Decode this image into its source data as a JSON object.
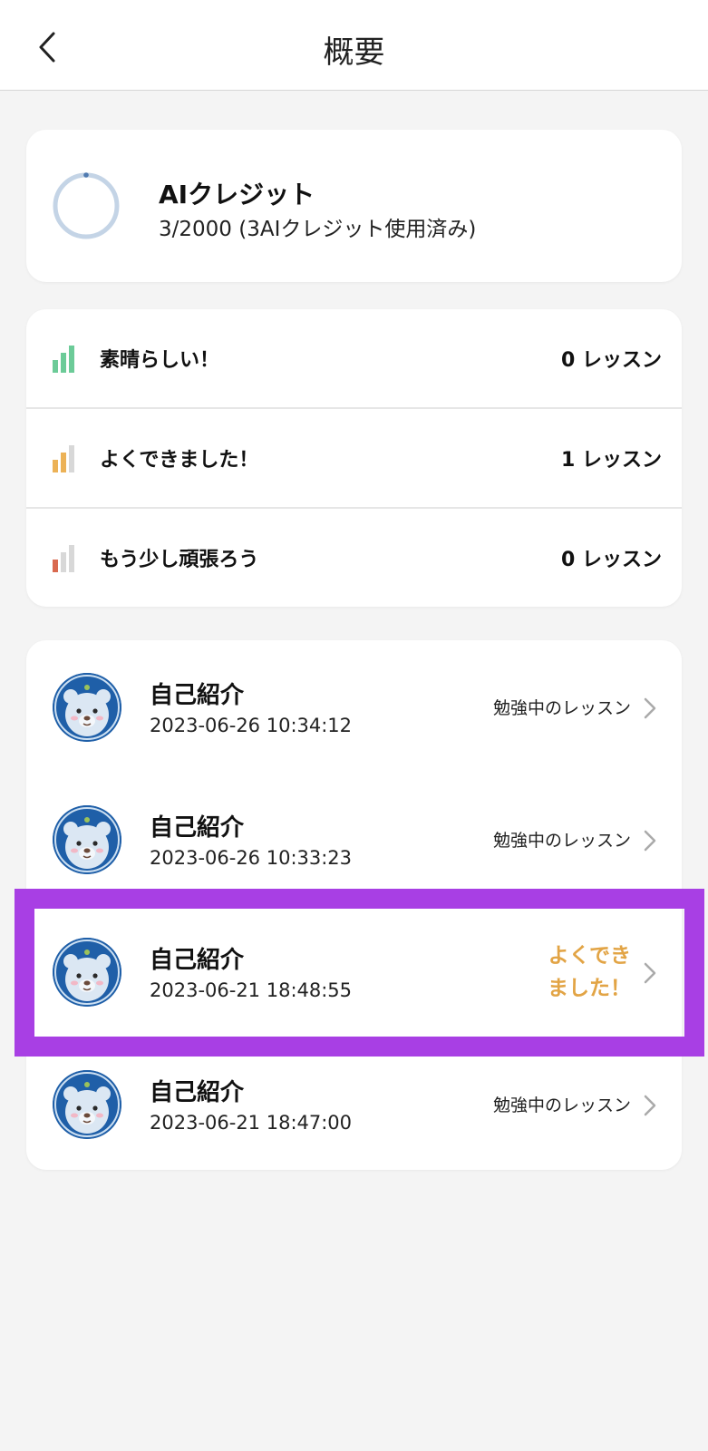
{
  "header": {
    "title": "概要"
  },
  "credits": {
    "title": "AIクレジット",
    "used": 3,
    "total": 2000,
    "subtitle": "3/2000 (3AIクレジット使用済み)"
  },
  "stats": [
    {
      "label": "素晴らしい！",
      "count_text": "0 レッスン",
      "level": 3,
      "color": "#6ccb98"
    },
    {
      "label": "よくできました！",
      "count_text": "1 レッスン",
      "level": 2,
      "color": "#ecb257"
    },
    {
      "label": "もう少し頑張ろう",
      "count_text": "0 レッスン",
      "level": 1,
      "color": "#d9694f"
    }
  ],
  "lessons": [
    {
      "title": "自己紹介",
      "date": "2023-06-26 10:34:12",
      "status": "勉強中のレッスン"
    },
    {
      "title": "自己紹介",
      "date": "2023-06-26 10:33:23",
      "status": "勉強中のレッスン"
    },
    {
      "title": "自己紹介",
      "date": "2023-06-21 18:48:55",
      "status": "よくでき\nました！",
      "highlighted": true
    },
    {
      "title": "自己紹介",
      "date": "2023-06-21 18:47:00",
      "status": "勉強中のレッスン"
    }
  ],
  "colors": {
    "highlight": "#a83fe4",
    "good_status": "#e2a445",
    "ring": "#c4d4e6",
    "ring_progress": "#4f7ab0"
  }
}
